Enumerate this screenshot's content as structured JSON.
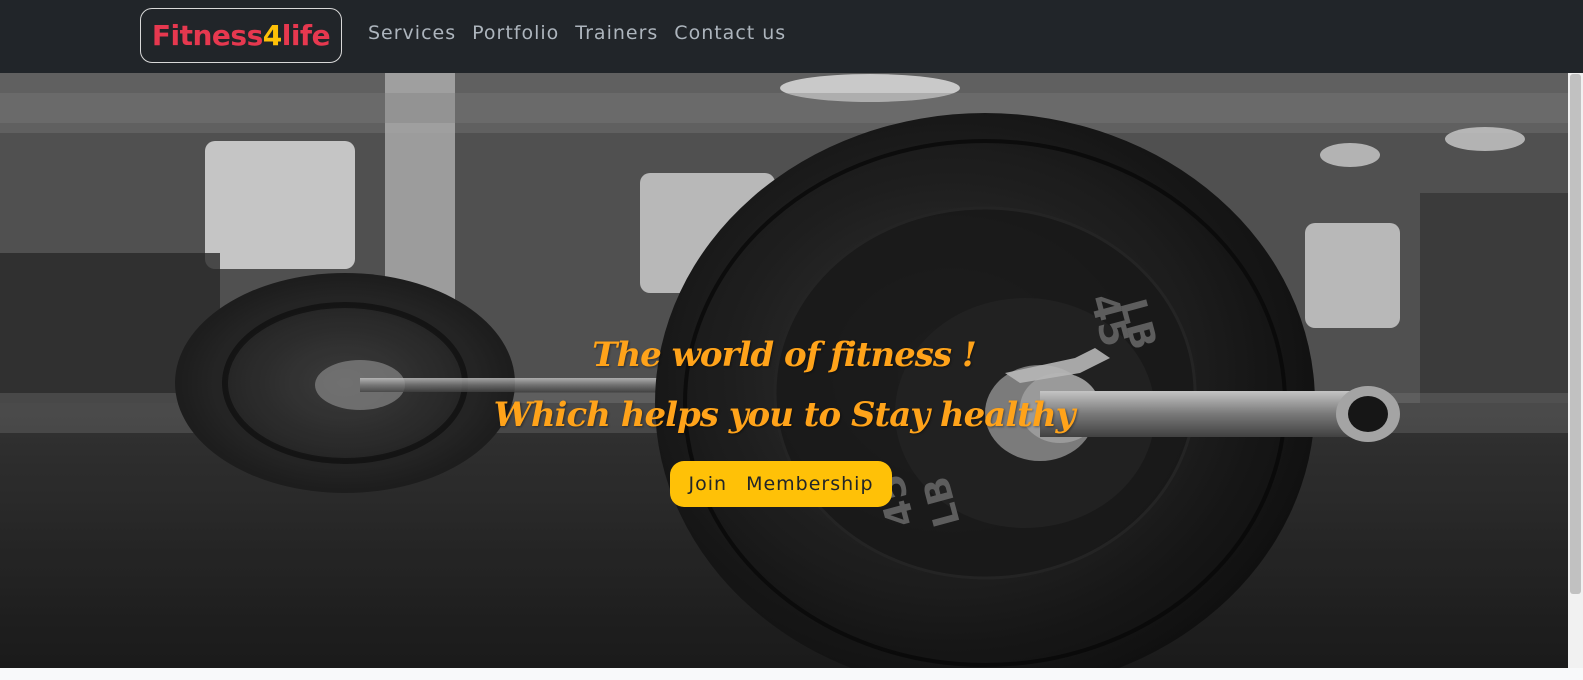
{
  "navbar": {
    "brand": {
      "part1": "Fitness",
      "part2": "4",
      "part3": "life"
    },
    "links": [
      {
        "label": "Services"
      },
      {
        "label": "Portfolio"
      },
      {
        "label": "Trainers"
      },
      {
        "label": "Contact us"
      }
    ]
  },
  "hero": {
    "headline_1": "The world of fitness !",
    "headline_2": "Which helps you to Stay healthy",
    "cta_label": "Join Membership",
    "background": "gym-barbell-photo"
  },
  "colors": {
    "navbar_bg": "#212529",
    "brand_red": "#e6384f",
    "brand_yellow": "#ffc107",
    "headline": "#ffa31a",
    "cta_bg": "#ffc107"
  }
}
